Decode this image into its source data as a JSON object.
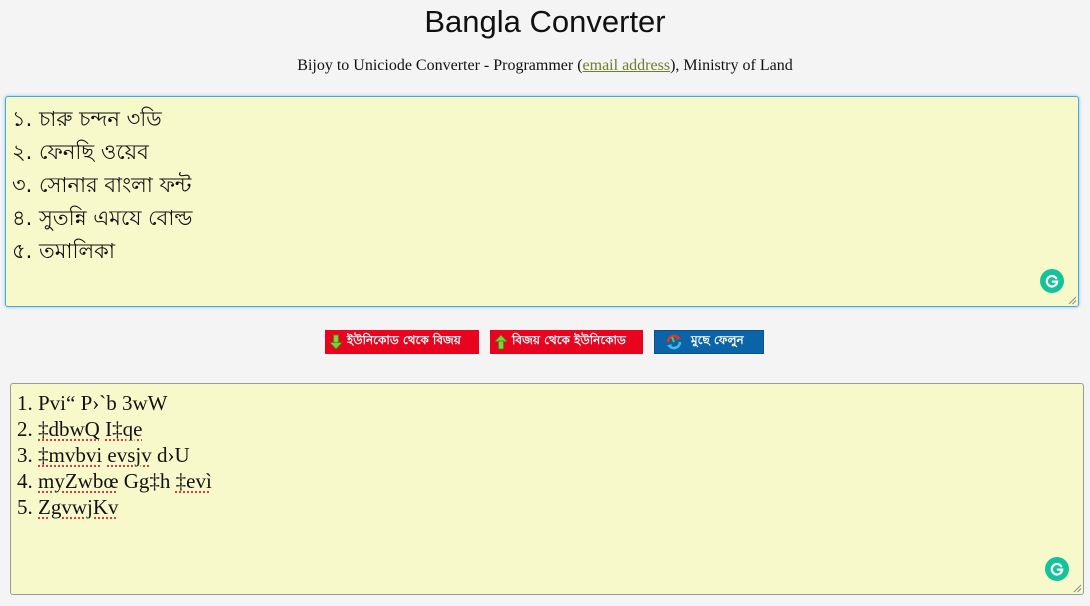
{
  "header": {
    "title": "Bangla Converter",
    "subtitle_before": "Bijoy to Uniciode Converter - Programmer (",
    "email_link": "email address",
    "subtitle_after": "), Ministry of Land"
  },
  "input_box": {
    "lines": [
      "১. চারু চন্দন ৩ডি",
      "২. ফেনছি ওয়েব",
      "৩. সোনার বাংলা ফন্ট",
      "৪. সুতন্নি এমযে বোল্ড",
      "৫. তমালিকা"
    ]
  },
  "buttons": {
    "unicode_to_bijoy": "ইউনিকোড থেকে বিজয়",
    "bijoy_to_unicode": "বিজয় থেকে ইউনিকোড",
    "clear": "মুছে ফেলুন"
  },
  "output_box": {
    "lines": [
      {
        "prefix": "1. ",
        "parts": [
          {
            "t": "Pvi“ P›`b 3wW",
            "err": false
          }
        ]
      },
      {
        "prefix": "2. ",
        "parts": [
          {
            "t": "‡dbwQ",
            "err": true
          },
          {
            "t": " ",
            "err": false
          },
          {
            "t": "I‡qe",
            "err": true
          }
        ]
      },
      {
        "prefix": "3. ",
        "parts": [
          {
            "t": "‡mvbvi",
            "err": true
          },
          {
            "t": " ",
            "err": false
          },
          {
            "t": "evsjv",
            "err": true
          },
          {
            "t": " d›U",
            "err": false
          }
        ]
      },
      {
        "prefix": "4. ",
        "parts": [
          {
            "t": "myZwbœ",
            "err": true
          },
          {
            "t": " Gg‡h ",
            "err": false
          },
          {
            "t": "‡evì",
            "err": true
          }
        ]
      },
      {
        "prefix": "5. ",
        "parts": [
          {
            "t": "ZgvwjKv",
            "err": true
          }
        ]
      }
    ]
  },
  "colors": {
    "textbox_bg": "#f8f9cb",
    "red_button": "#e8041f",
    "blue_button": "#0b63a8",
    "grammarly": "#15c39a",
    "link": "#6b7f2e"
  },
  "icons": {
    "btn1": "arrow-down-icon",
    "btn2": "arrow-up-icon",
    "btn3": "refresh-icon",
    "textbox": "grammarly-icon"
  }
}
